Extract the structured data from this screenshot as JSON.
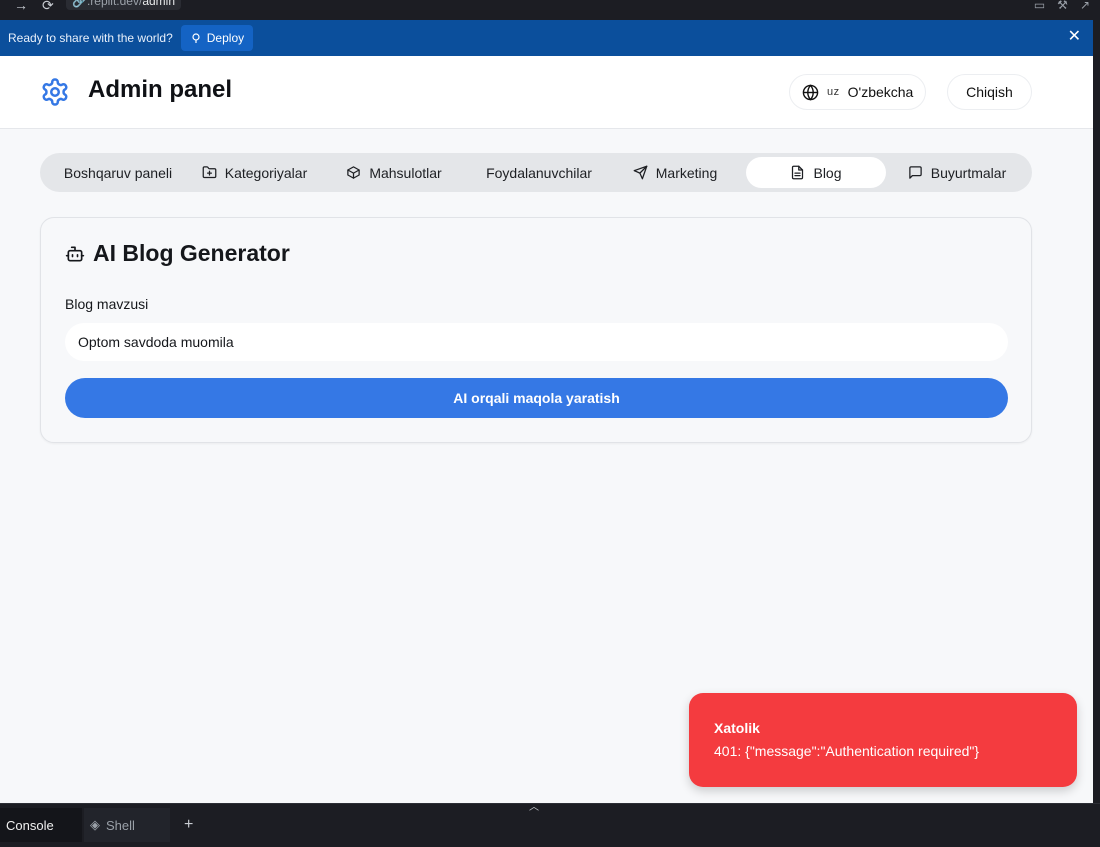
{
  "browser": {
    "url_prefix": ".replit.dev/",
    "url_path": "admin"
  },
  "banner": {
    "text": "Ready to share with the world?",
    "deploy_label": "Deploy"
  },
  "header": {
    "title": "Admin panel",
    "lang_code": "uz",
    "lang_label": "O'zbekcha",
    "logout_label": "Chiqish"
  },
  "tabs": [
    {
      "label": "Boshqaruv paneli",
      "icon": "none"
    },
    {
      "label": "Kategoriyalar",
      "icon": "folder-plus-icon"
    },
    {
      "label": "Mahsulotlar",
      "icon": "package-icon"
    },
    {
      "label": "Foydalanuvchilar",
      "icon": "none"
    },
    {
      "label": "Marketing",
      "icon": "send-icon"
    },
    {
      "label": "Blog",
      "icon": "file-text-icon",
      "active": true
    },
    {
      "label": "Buyurtmalar",
      "icon": "message-square-icon"
    }
  ],
  "blog": {
    "title": "AI Blog Generator",
    "field_label": "Blog mavzusi",
    "input_value": "Optom savdoda muomila",
    "generate_label": "AI orqali maqola yaratish"
  },
  "toast": {
    "title": "Xatolik",
    "message": "401: {\"message\":\"Authentication required\"}"
  },
  "bottom_panel": {
    "tabs": [
      "Console",
      "Shell"
    ],
    "add_label": "+"
  },
  "colors": {
    "banner_bg": "#0b4f9c",
    "accent": "#3578e5",
    "toast_bg": "#f43b3f",
    "app_bg": "#f7f8fa"
  }
}
